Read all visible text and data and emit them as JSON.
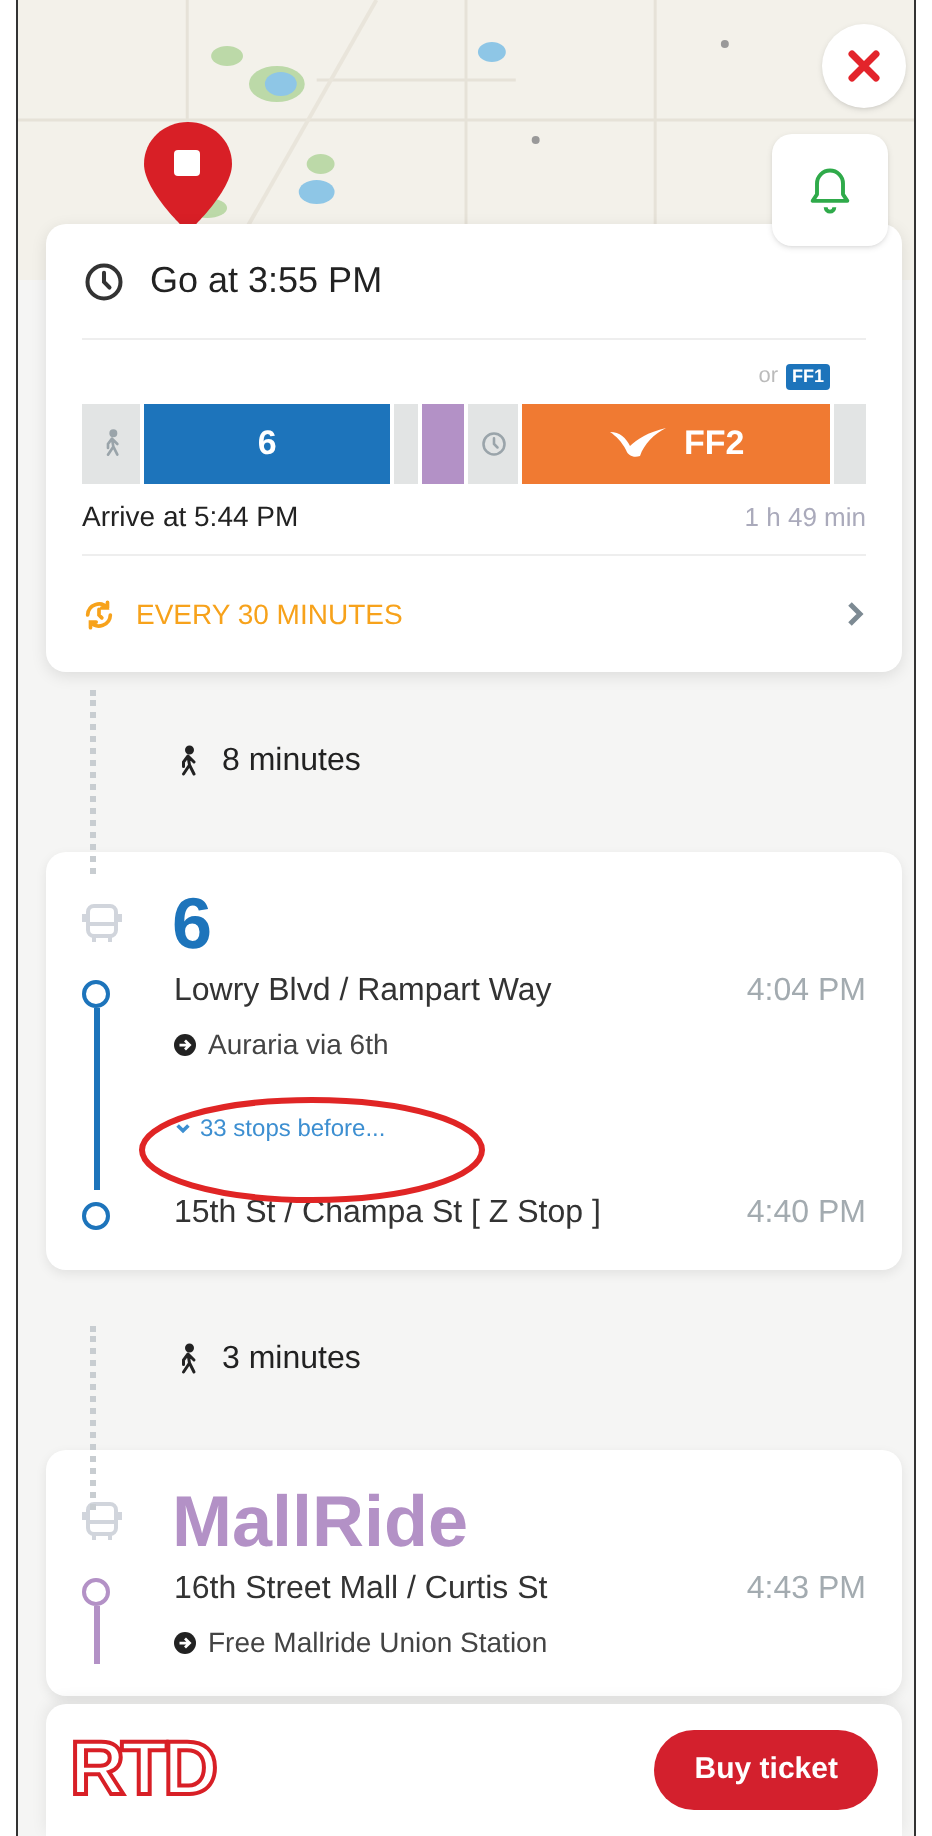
{
  "summary": {
    "depart": "Go at 3:55 PM",
    "alternative": {
      "prefix": "or",
      "route": "FF1"
    },
    "segments": [
      {
        "kind": "walk"
      },
      {
        "kind": "route",
        "label": "6",
        "color": "#1d74bb"
      },
      {
        "kind": "transfer"
      },
      {
        "kind": "route",
        "color": "#b391c6"
      },
      {
        "kind": "wait"
      },
      {
        "kind": "express",
        "label": "FF2",
        "color": "#f07a32"
      },
      {
        "kind": "transfer"
      }
    ],
    "arrive": "Arrive at 5:44 PM",
    "duration": "1 h 49 min",
    "frequency": "EVERY 30 MINUTES"
  },
  "legs": [
    {
      "kind": "walk",
      "text": "8 minutes"
    },
    {
      "kind": "bus",
      "route": "6",
      "color": "#1d74bb",
      "stops": [
        {
          "name": "Lowry Blvd / Rampart Way",
          "time": "4:04 PM",
          "direction": "Auraria via 6th"
        },
        {
          "name": "15th St / Champa St [ Z Stop ]",
          "time": "4:40 PM"
        }
      ],
      "collapsed": "33 stops before..."
    },
    {
      "kind": "walk",
      "text": "3 minutes"
    },
    {
      "kind": "bus",
      "route": "MallRide",
      "color": "#b391c6",
      "stops": [
        {
          "name": "16th Street Mall / Curtis St",
          "time": "4:43 PM",
          "direction": "Free Mallride Union Station"
        }
      ]
    }
  ],
  "footer": {
    "logo": "RTD",
    "button": "Buy ticket"
  }
}
